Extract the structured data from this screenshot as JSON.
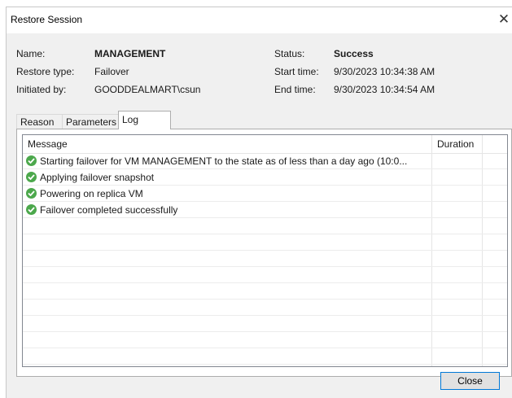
{
  "window": {
    "title": "Restore Session",
    "close_glyph": "✕"
  },
  "info": {
    "name_label": "Name:",
    "name_value": "MANAGEMENT",
    "restore_type_label": "Restore type:",
    "restore_type_value": "Failover",
    "initiated_by_label": "Initiated by:",
    "initiated_by_value": "GOODDEALMART\\csun",
    "status_label": "Status:",
    "status_value": "Success",
    "start_time_label": "Start time:",
    "start_time_value": "9/30/2023 10:34:38 AM",
    "end_time_label": "End time:",
    "end_time_value": "9/30/2023 10:34:54 AM"
  },
  "tabs": [
    {
      "label": "Reason"
    },
    {
      "label": "Parameters"
    },
    {
      "label": "Log",
      "active": true
    }
  ],
  "log": {
    "columns": {
      "message": "Message",
      "duration": "Duration"
    },
    "rows": [
      {
        "message": "Starting failover for VM MANAGEMENT to the state as of less than a day ago (10:0...",
        "status_icon": "success-check-icon"
      },
      {
        "message": "Applying failover snapshot",
        "status_icon": "success-check-icon"
      },
      {
        "message": "Powering on replica VM",
        "status_icon": "success-check-icon"
      },
      {
        "message": "Failover completed successfully",
        "status_icon": "success-check-icon"
      }
    ]
  },
  "buttons": {
    "close_label": "Close"
  },
  "colors": {
    "success": "#4ca84c",
    "accent": "#0078d7"
  }
}
